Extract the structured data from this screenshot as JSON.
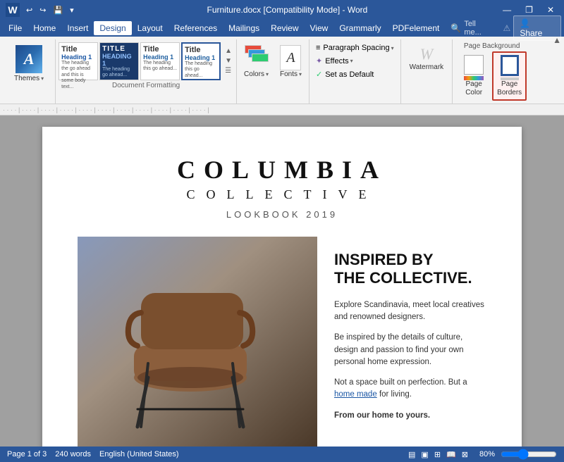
{
  "titlebar": {
    "filename": "Furniture.docx [Compatibility Mode] - Word",
    "wordIconLabel": "W",
    "quickAccess": [
      "↩",
      "↪",
      "💾"
    ],
    "controls": [
      "—",
      "❐",
      "✕"
    ]
  },
  "menubar": {
    "items": [
      "File",
      "Home",
      "Insert",
      "Design",
      "Layout",
      "References",
      "Mailings",
      "Review",
      "View",
      "Grammarly",
      "PDFelement"
    ],
    "activeItem": "Design",
    "searchPlaceholder": "Tell me...",
    "shareLabel": "Share"
  },
  "ribbon": {
    "groups": [
      {
        "name": "themes",
        "label": "Themes",
        "buttons": [
          {
            "label": "Themes",
            "icon": "A"
          }
        ]
      },
      {
        "name": "document-formatting",
        "label": "Document Formatting",
        "styles": [
          {
            "title": "Title",
            "h": "Heading 1",
            "body": "The heading the go ahead and..."
          },
          {
            "title": "TITLE",
            "h": "HEADING 1",
            "body": "The heading go ahead..."
          },
          {
            "title": "Title",
            "h": "Heading 1",
            "body": "The heading this go ahead..."
          },
          {
            "title": "Title",
            "h": "Heading 1",
            "body": "The heading this go ahead..."
          }
        ]
      },
      {
        "name": "colors-fonts",
        "buttons": [
          {
            "label": "Colors",
            "icon": "🎨"
          },
          {
            "label": "Fonts",
            "icon": "A"
          }
        ]
      },
      {
        "name": "para-effects",
        "buttons": [
          {
            "label": "Paragraph Spacing",
            "icon": "≡"
          },
          {
            "label": "Effects",
            "icon": "✦"
          },
          {
            "label": "Set as Default",
            "icon": "✓"
          }
        ]
      },
      {
        "name": "watermark",
        "label": "Watermark",
        "buttons": [
          {
            "label": "Watermark",
            "icon": "W"
          }
        ]
      },
      {
        "name": "page-background",
        "label": "Page Background",
        "buttons": [
          {
            "label": "Page Color",
            "icon": "🎨"
          },
          {
            "label": "Page Borders",
            "icon": "▭",
            "highlighted": true
          }
        ]
      }
    ]
  },
  "document": {
    "titleLine1": "COLUMBIA",
    "titleLine2": "COLLECTIVE",
    "lookbook": "LOOKBOOK 2019",
    "inspiredHeading": "INSPIRED BY\nTHE COLLECTIVE.",
    "para1": "Explore Scandinavia, meet local creatives and renowned designers.",
    "para2": "Be inspired by the details of culture, design and passion to find your own personal home expression.",
    "para3": "Not a space built on perfection. But a",
    "linkText": "home made",
    "para3end": " for living.",
    "para4": "From our home to yours."
  },
  "statusbar": {
    "page": "Page 1 of 3",
    "words": "240 words",
    "language": "English (United States)",
    "zoom": "80%",
    "viewIcons": [
      "▤",
      "▣",
      "⊞",
      "📖",
      "⊠"
    ]
  }
}
